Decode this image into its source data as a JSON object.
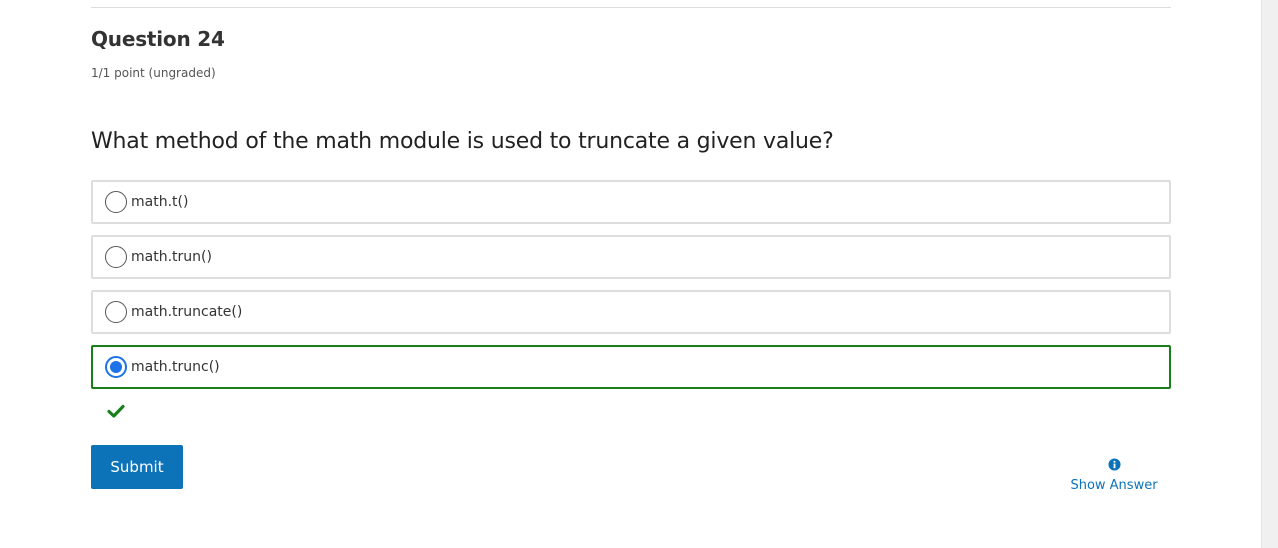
{
  "question": {
    "title": "Question 24",
    "points": "1/1 point (ungraded)",
    "prompt": "What method of the math module is used to truncate a given value?"
  },
  "options": [
    {
      "label": "math.t()",
      "selected": false
    },
    {
      "label": "math.trun()",
      "selected": false
    },
    {
      "label": "math.truncate()",
      "selected": false
    },
    {
      "label": "math.trunc()",
      "selected": true,
      "correct": true
    }
  ],
  "feedback": {
    "icon": "checkmark-icon",
    "status": "correct",
    "color": "#1a7f1a"
  },
  "actions": {
    "submit_label": "Submit",
    "show_answer_label": "Show Answer",
    "show_answer_icon": "info-icon"
  },
  "colors": {
    "accent": "#0c73b8",
    "radio_selected": "#1d72e8",
    "correct_border": "#1a7f1a"
  }
}
